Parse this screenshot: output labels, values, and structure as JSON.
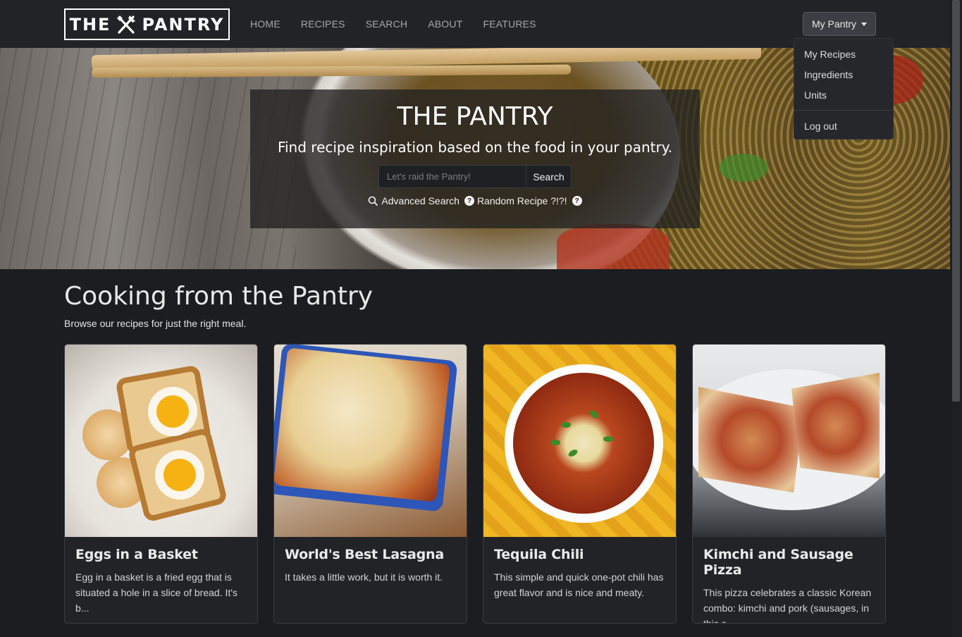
{
  "app": {
    "logo_left": "THE",
    "logo_right": "PANTRY"
  },
  "nav": {
    "links": [
      "HOME",
      "RECIPES",
      "SEARCH",
      "ABOUT",
      "FEATURES"
    ],
    "account_button": "My Pantry",
    "dropdown": [
      "My Recipes",
      "Ingredients",
      "Units",
      "Log out"
    ]
  },
  "hero": {
    "title": "THE PANTRY",
    "subtitle": "Find recipe inspiration based on the food in your pantry.",
    "search_placeholder": "Let's raid the Pantry!",
    "search_button": "Search",
    "advanced_search": "Advanced Search",
    "random_recipe": "Random Recipe ?!?!"
  },
  "section": {
    "title": "Cooking from the Pantry",
    "subtitle": "Browse our recipes for just the right meal."
  },
  "cards": [
    {
      "title": "Eggs in a Basket",
      "text": "Egg in a basket is a fried egg that is situated a hole in a slice of bread. It's b..."
    },
    {
      "title": "World's Best Lasagna",
      "text": "It takes a little work, but it is worth it."
    },
    {
      "title": "Tequila Chili",
      "text": "This simple and quick one-pot chili has great flavor and is nice and meaty."
    },
    {
      "title": "Kimchi and Sausage Pizza",
      "text": "This pizza celebrates a classic Korean combo: kimchi and pork (sausages, in this c..."
    }
  ],
  "colors": {
    "background": "#1b1d20",
    "navbar": "#212326",
    "card": "#212326"
  }
}
